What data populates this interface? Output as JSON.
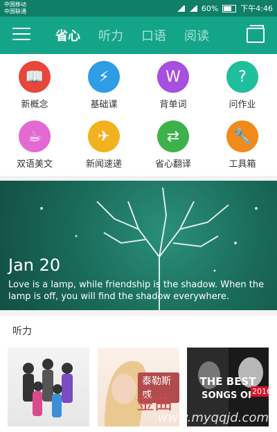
{
  "statusbar": {
    "carrier1": "中国移动",
    "carrier2": "中国联通",
    "battery": "60%",
    "time": "下午4:46"
  },
  "appbar": {
    "tabs": [
      "省心",
      "听力",
      "口语",
      "阅读"
    ]
  },
  "grid": {
    "items": [
      {
        "label": "新概念",
        "icon": "book-icon",
        "color": "#e8463b"
      },
      {
        "label": "基础课",
        "icon": "lightning-icon",
        "color": "#2f9ce6"
      },
      {
        "label": "背单词",
        "icon": "word-icon",
        "color": "#a64fe0"
      },
      {
        "label": "问作业",
        "icon": "help-icon",
        "color": "#1fbf9e"
      },
      {
        "label": "双语美文",
        "icon": "cup-icon",
        "color": "#e26ad2"
      },
      {
        "label": "新闻速递",
        "icon": "plane-icon",
        "color": "#f2b21e"
      },
      {
        "label": "省心翻译",
        "icon": "translate-icon",
        "color": "#3db24a"
      },
      {
        "label": "工具箱",
        "icon": "tools-icon",
        "color": "#f08a1a"
      }
    ]
  },
  "banner": {
    "date": "Jan 20",
    "quote": "Love is a lamp, while friendship is the shadow. When the lamp is off, you will find the shadow everywhere."
  },
  "section": {
    "title": "听力",
    "card2_text1": "泰勒斯威",
    "card2_text2": "金曲",
    "card3_text1": "THE BEST",
    "card3_text2": "SONGS OF",
    "card3_text3": "2016",
    "watermark": "www.myqqjd.com"
  }
}
